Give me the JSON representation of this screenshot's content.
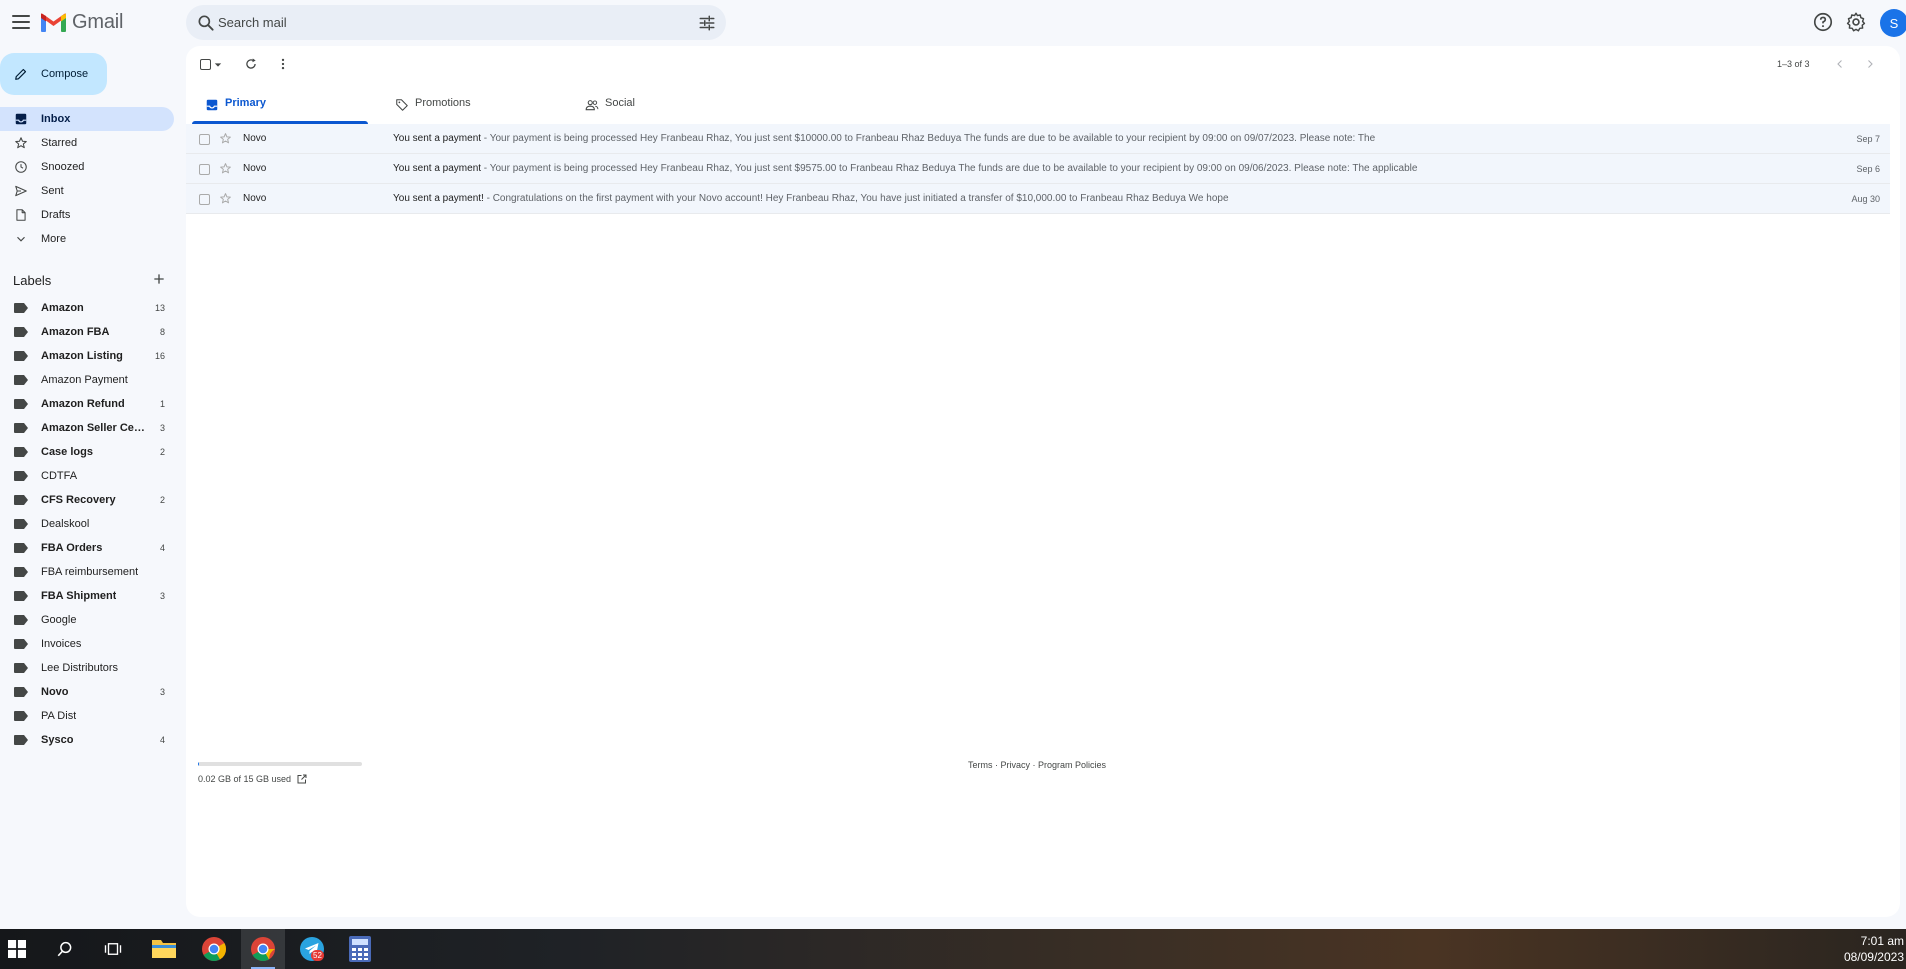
{
  "app": {
    "name": "Gmail"
  },
  "search": {
    "placeholder": "Search mail"
  },
  "compose": {
    "label": "Compose"
  },
  "nav": {
    "items": [
      {
        "label": "Inbox",
        "icon": "inbox-icon",
        "active": true
      },
      {
        "label": "Starred",
        "icon": "star-icon"
      },
      {
        "label": "Snoozed",
        "icon": "clock-icon"
      },
      {
        "label": "Sent",
        "icon": "send-icon"
      },
      {
        "label": "Drafts",
        "icon": "draft-icon"
      },
      {
        "label": "More",
        "icon": "chevron-down-icon"
      }
    ]
  },
  "labels": {
    "title": "Labels",
    "items": [
      {
        "label": "Amazon",
        "count": "13",
        "bold": true
      },
      {
        "label": "Amazon FBA",
        "count": "8",
        "bold": true
      },
      {
        "label": "Amazon Listing",
        "count": "16",
        "bold": true
      },
      {
        "label": "Amazon Payment",
        "count": "",
        "bold": false
      },
      {
        "label": "Amazon Refund",
        "count": "1",
        "bold": true
      },
      {
        "label": "Amazon Seller Cen...",
        "count": "3",
        "bold": true
      },
      {
        "label": "Case logs",
        "count": "2",
        "bold": true
      },
      {
        "label": "CDTFA",
        "count": "",
        "bold": false
      },
      {
        "label": "CFS Recovery",
        "count": "2",
        "bold": true
      },
      {
        "label": "Dealskool",
        "count": "",
        "bold": false
      },
      {
        "label": "FBA Orders",
        "count": "4",
        "bold": true
      },
      {
        "label": "FBA reimbursement",
        "count": "",
        "bold": false
      },
      {
        "label": "FBA Shipment",
        "count": "3",
        "bold": true
      },
      {
        "label": "Google",
        "count": "",
        "bold": false
      },
      {
        "label": "Invoices",
        "count": "",
        "bold": false
      },
      {
        "label": "Lee Distributors",
        "count": "",
        "bold": false
      },
      {
        "label": "Novo",
        "count": "3",
        "bold": true
      },
      {
        "label": "PA Dist",
        "count": "",
        "bold": false
      },
      {
        "label": "Sysco",
        "count": "4",
        "bold": true
      }
    ]
  },
  "toolbar": {
    "pager": "1–3 of 3"
  },
  "tabs": [
    {
      "label": "Primary",
      "icon": "inbox-icon",
      "active": true
    },
    {
      "label": "Promotions",
      "icon": "tag-icon",
      "active": false
    },
    {
      "label": "Social",
      "icon": "people-icon",
      "active": false
    }
  ],
  "emails": [
    {
      "sender": "Novo",
      "subject": "You sent a payment",
      "snippet": " - Your payment is being processed Hey Franbeau Rhaz, You just sent $10000.00 to Franbeau Rhaz Beduya The funds are due to be available to your recipient by 09:00 on 09/07/2023. Please note: The",
      "date": "Sep 7"
    },
    {
      "sender": "Novo",
      "subject": "You sent a payment",
      "snippet": " - Your payment is being processed Hey Franbeau Rhaz, You just sent $9575.00 to Franbeau Rhaz Beduya The funds are due to be available to your recipient by 09:00 on 09/06/2023. Please note: The applicable",
      "date": "Sep 6"
    },
    {
      "sender": "Novo",
      "subject": "You sent a payment!",
      "snippet": " - Congratulations on the first payment with your Novo account! Hey Franbeau Rhaz, You have just initiated a transfer of $10,000.00 to Franbeau Rhaz Beduya We hope",
      "date": "Aug 30"
    }
  ],
  "storage": {
    "text": "0.02 GB of 15 GB used",
    "fraction": 0.0013
  },
  "footer": {
    "terms": "Terms",
    "privacy": "Privacy",
    "policies": "Program Policies",
    "sep": " · "
  },
  "avatar": {
    "initial": "S"
  },
  "taskbar": {
    "time": "7:01 am",
    "date": "08/09/2023",
    "telegram_badge": "52"
  },
  "colors": {
    "accent": "#0b57d0",
    "compose_bg": "#c2e7ff",
    "active_nav": "#d3e3fd"
  }
}
